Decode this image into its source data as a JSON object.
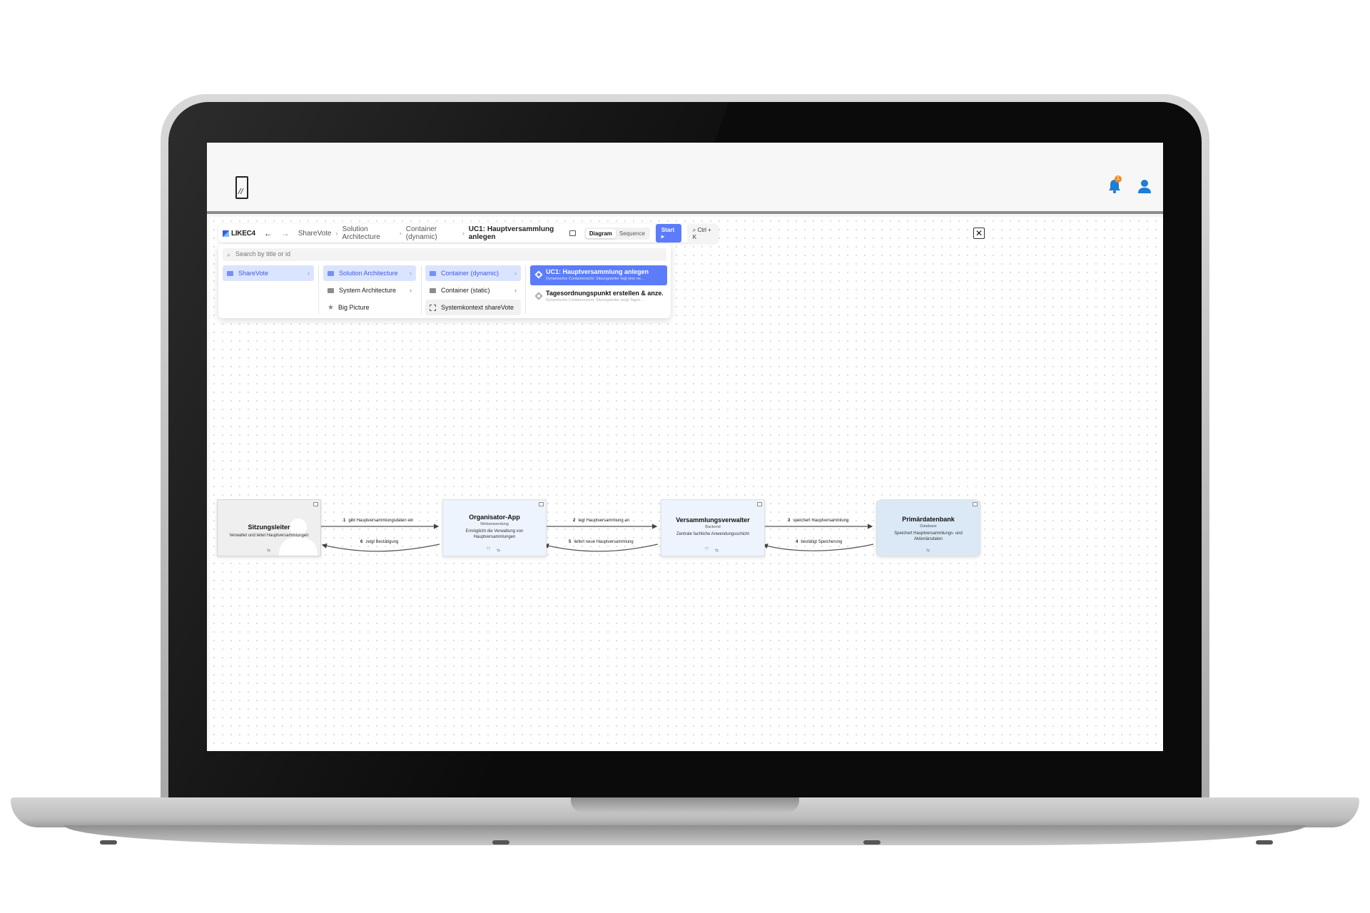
{
  "app": {
    "logo_glyph": "//",
    "notifications_count": "1"
  },
  "toolbar": {
    "brand": "LIKEC4",
    "breadcrumbs": [
      "ShareVote",
      "Solution Architecture",
      "Container (dynamic)"
    ],
    "current": "UC1: Hauptversammlung anlegen",
    "mode_diagram": "Diagram",
    "mode_sequence": "Sequence",
    "start_label": "Start",
    "search_shortcut": "Ctrl + K",
    "close_glyph": "✕"
  },
  "navigator": {
    "search_placeholder": "Search by title or id",
    "col1": [
      {
        "label": "ShareVote"
      }
    ],
    "col2": [
      {
        "label": "Solution Architecture"
      },
      {
        "label": "System Architecture"
      },
      {
        "label": "Big Picture"
      }
    ],
    "col3": [
      {
        "label": "Container (dynamic)"
      },
      {
        "label": "Container (static)"
      },
      {
        "label": "Systemkontext shareVote"
      }
    ],
    "views": [
      {
        "title": "UC1: Hauptversammlung anlegen",
        "desc": "Dynamische Containersicht: Sitzungsleiter legt eine ne..."
      },
      {
        "title": "Tagesordnungspunkt erstellen & anze...",
        "desc": "Dynamische Containersicht: Sitzungsleiter zeigt Tages..."
      }
    ]
  },
  "diagram": {
    "nodes": [
      {
        "title": "Sitzungsleiter",
        "tech": "",
        "desc": "Verwaltet und leitet Hauptversammlungen"
      },
      {
        "title": "Organisator-App",
        "tech": "Webanwendung",
        "desc": "Ermöglicht die Verwaltung von Hauptversammlungen"
      },
      {
        "title": "Versammlungsverwalter",
        "tech": "Backend",
        "desc": "Zentrale fachliche Anwendungsschicht"
      },
      {
        "title": "Primärdatenbank",
        "tech": "Database",
        "desc": "Speichert Hauptversammlungs- und Aktionärsdaten"
      }
    ],
    "edges": [
      {
        "num": "1",
        "label": "gibt Hauptversammlungsdaten ein"
      },
      {
        "num": "2",
        "label": "legt Hauptversammlung an"
      },
      {
        "num": "3",
        "label": "speichert Hauptversammlung"
      },
      {
        "num": "4",
        "label": "bestätigt Speicherung"
      },
      {
        "num": "5",
        "label": "liefert neue Hauptversammlung"
      },
      {
        "num": "6",
        "label": "zeigt Bestätigung"
      }
    ]
  },
  "colors": {
    "accent": "#5c7cfa",
    "selected_bg": "#dbe4ff",
    "notification": "#f28c28",
    "icon_blue": "#1c7ed6"
  }
}
